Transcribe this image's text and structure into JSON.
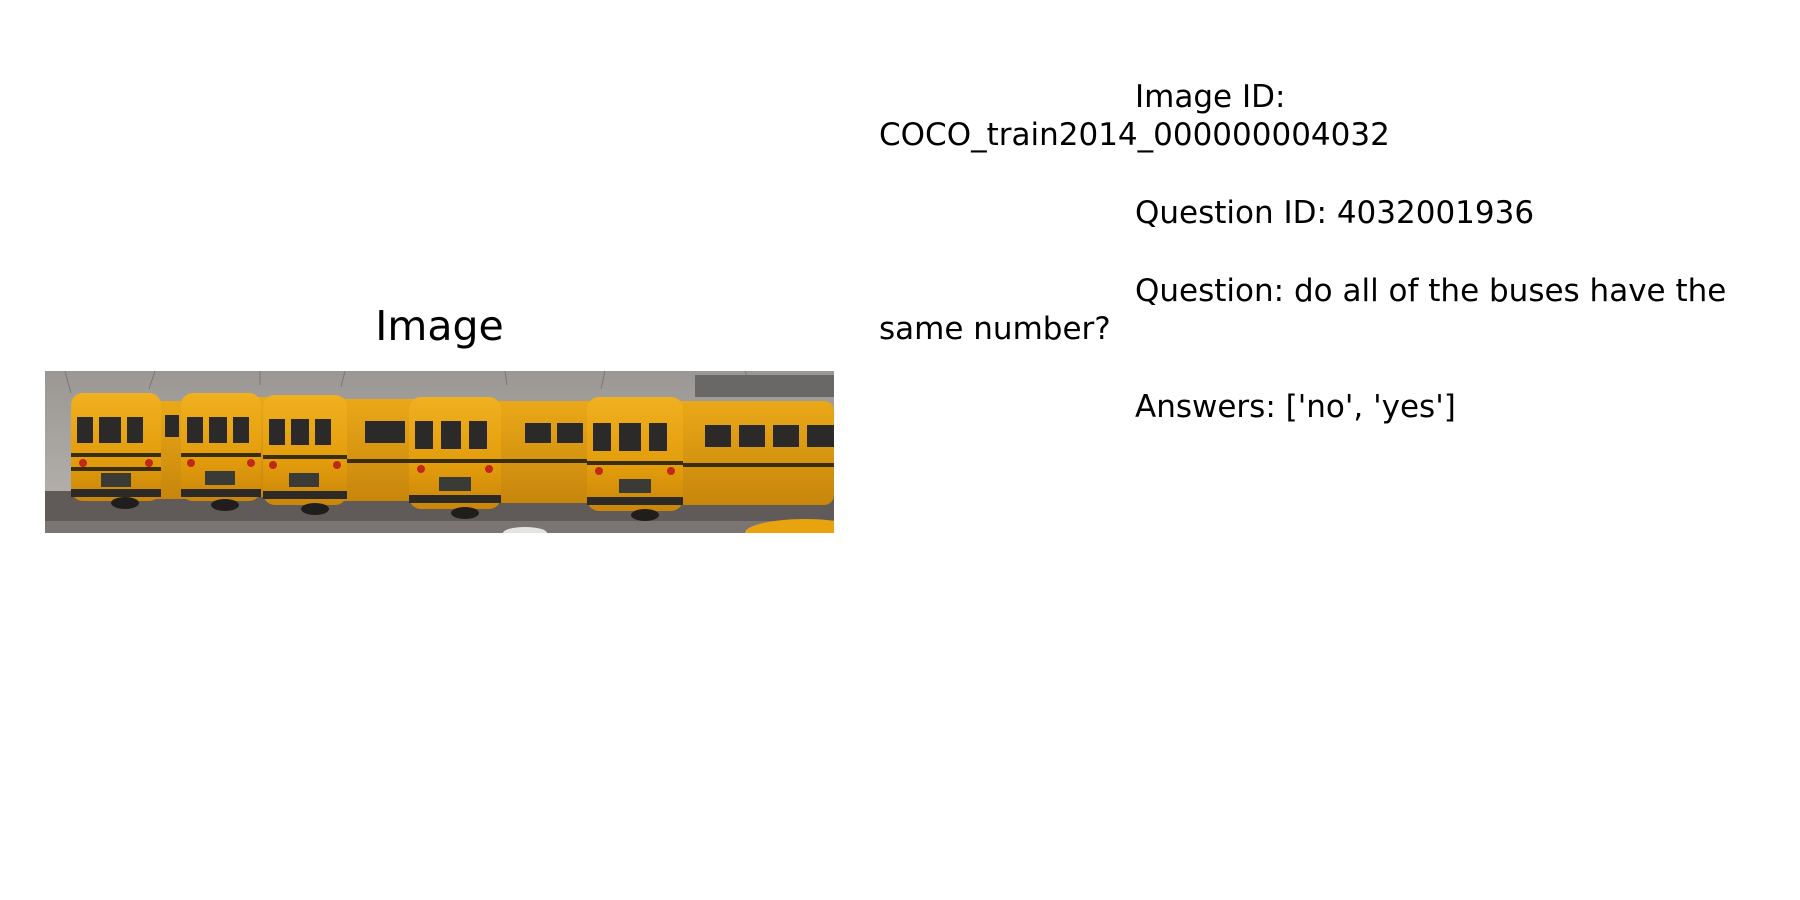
{
  "panel_title": "Image",
  "info": {
    "image_id_label": "Image ID:",
    "image_id": "COCO_train2014_000000004032",
    "question_id_label": "Question ID:",
    "question_id": "4032001936",
    "question_label": "Question:",
    "question": "do all of the buses have the same number?",
    "answers_label": "Answers:",
    "answers": "['no', 'yes']"
  },
  "colors": {
    "bus_yellow": "#e8a10c",
    "sky": "#8c8a87",
    "ground": "#5a5654"
  }
}
